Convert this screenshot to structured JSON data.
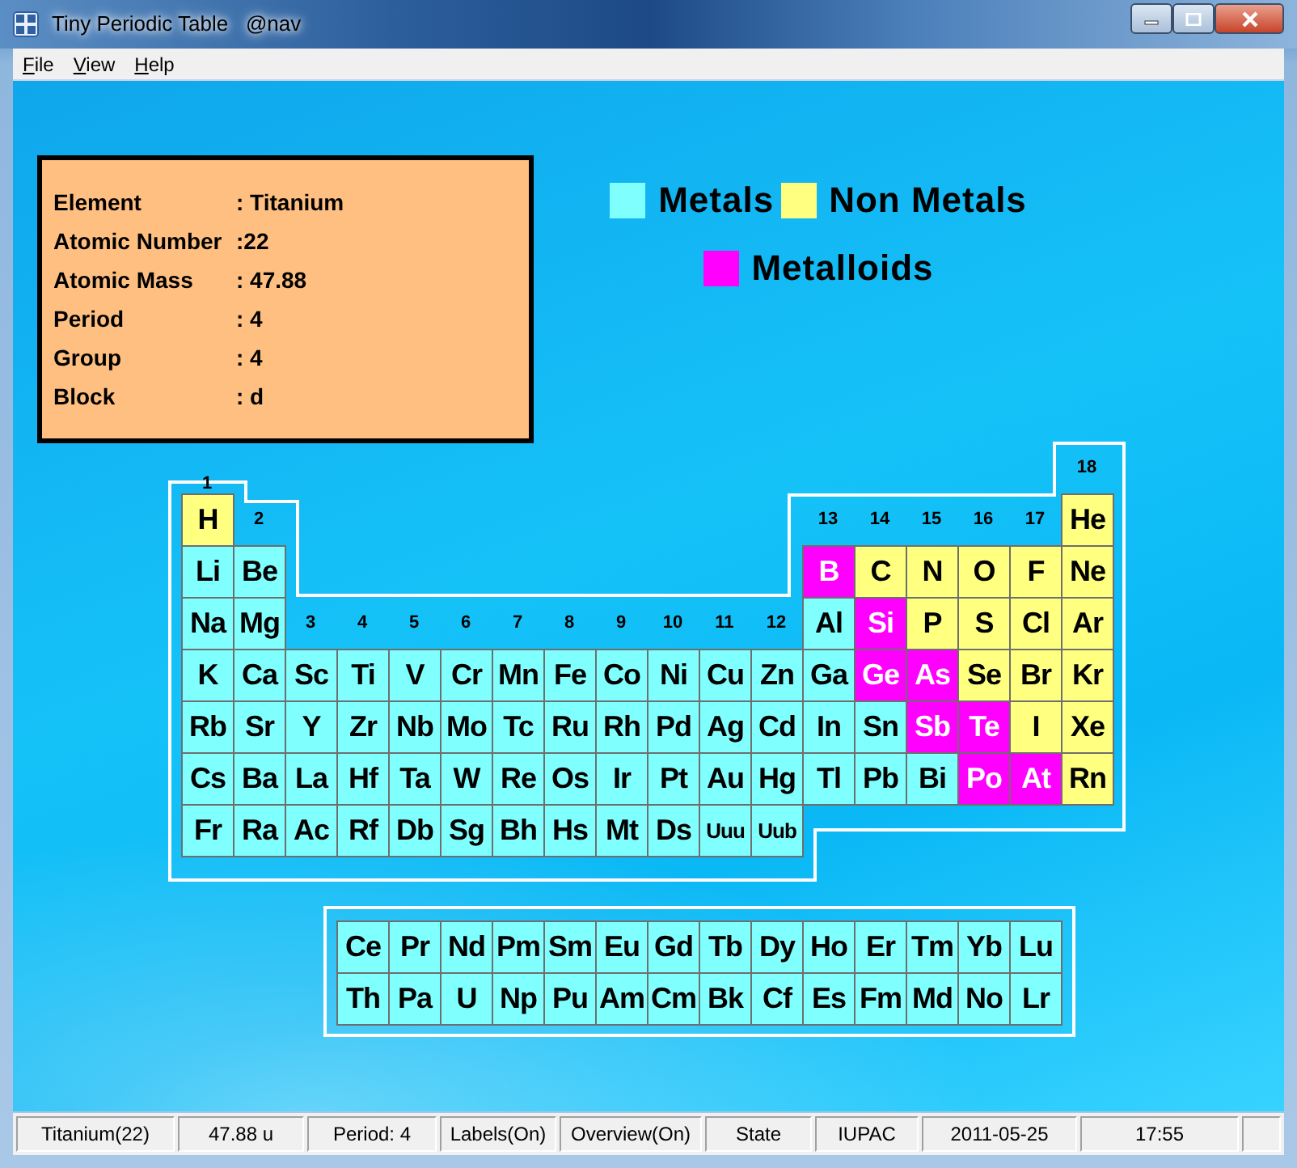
{
  "window": {
    "title": "Tiny Periodic Table   @nav"
  },
  "menu": [
    "File",
    "View",
    "Help"
  ],
  "info": [
    {
      "label": "Element",
      "value": ": Titanium"
    },
    {
      "label": "Atomic Number",
      "value": ":22"
    },
    {
      "label": "Atomic Mass",
      "value": ": 47.88"
    },
    {
      "label": "Period",
      "value": ": 4"
    },
    {
      "label": "Group",
      "value": ": 4"
    },
    {
      "label": "Block",
      "value": ": d"
    }
  ],
  "legend": [
    {
      "kind": "metal",
      "label": "Metals",
      "color": "#80ffff"
    },
    {
      "kind": "nonmetal",
      "label": "Non Metals",
      "color": "#ffff80"
    },
    {
      "kind": "metalloid",
      "label": "Metalloids",
      "color": "#ff00ff"
    }
  ],
  "group_labels": [
    "1",
    "2",
    "3",
    "4",
    "5",
    "6",
    "7",
    "8",
    "9",
    "10",
    "11",
    "12",
    "13",
    "14",
    "15",
    "16",
    "17",
    "18"
  ],
  "table": {
    "rows": [
      [
        {
          "symbol": "H",
          "kind": "nonmetal"
        },
        null,
        null,
        null,
        null,
        null,
        null,
        null,
        null,
        null,
        null,
        null,
        null,
        null,
        null,
        null,
        null,
        {
          "symbol": "He",
          "kind": "nonmetal"
        }
      ],
      [
        {
          "symbol": "Li",
          "kind": "metal"
        },
        {
          "symbol": "Be",
          "kind": "metal"
        },
        null,
        null,
        null,
        null,
        null,
        null,
        null,
        null,
        null,
        null,
        {
          "symbol": "B",
          "kind": "metalloid"
        },
        {
          "symbol": "C",
          "kind": "nonmetal"
        },
        {
          "symbol": "N",
          "kind": "nonmetal"
        },
        {
          "symbol": "O",
          "kind": "nonmetal"
        },
        {
          "symbol": "F",
          "kind": "nonmetal"
        },
        {
          "symbol": "Ne",
          "kind": "nonmetal"
        }
      ],
      [
        {
          "symbol": "Na",
          "kind": "metal"
        },
        {
          "symbol": "Mg",
          "kind": "metal"
        },
        null,
        null,
        null,
        null,
        null,
        null,
        null,
        null,
        null,
        null,
        {
          "symbol": "Al",
          "kind": "metal"
        },
        {
          "symbol": "Si",
          "kind": "metalloid"
        },
        {
          "symbol": "P",
          "kind": "nonmetal"
        },
        {
          "symbol": "S",
          "kind": "nonmetal"
        },
        {
          "symbol": "Cl",
          "kind": "nonmetal"
        },
        {
          "symbol": "Ar",
          "kind": "nonmetal"
        }
      ],
      [
        {
          "symbol": "K",
          "kind": "metal"
        },
        {
          "symbol": "Ca",
          "kind": "metal"
        },
        {
          "symbol": "Sc",
          "kind": "metal"
        },
        {
          "symbol": "Ti",
          "kind": "metal"
        },
        {
          "symbol": "V",
          "kind": "metal"
        },
        {
          "symbol": "Cr",
          "kind": "metal"
        },
        {
          "symbol": "Mn",
          "kind": "metal"
        },
        {
          "symbol": "Fe",
          "kind": "metal"
        },
        {
          "symbol": "Co",
          "kind": "metal"
        },
        {
          "symbol": "Ni",
          "kind": "metal"
        },
        {
          "symbol": "Cu",
          "kind": "metal"
        },
        {
          "symbol": "Zn",
          "kind": "metal"
        },
        {
          "symbol": "Ga",
          "kind": "metal"
        },
        {
          "symbol": "Ge",
          "kind": "metalloid"
        },
        {
          "symbol": "As",
          "kind": "metalloid"
        },
        {
          "symbol": "Se",
          "kind": "nonmetal"
        },
        {
          "symbol": "Br",
          "kind": "nonmetal"
        },
        {
          "symbol": "Kr",
          "kind": "nonmetal"
        }
      ],
      [
        {
          "symbol": "Rb",
          "kind": "metal"
        },
        {
          "symbol": "Sr",
          "kind": "metal"
        },
        {
          "symbol": "Y",
          "kind": "metal"
        },
        {
          "symbol": "Zr",
          "kind": "metal"
        },
        {
          "symbol": "Nb",
          "kind": "metal"
        },
        {
          "symbol": "Mo",
          "kind": "metal"
        },
        {
          "symbol": "Tc",
          "kind": "metal"
        },
        {
          "symbol": "Ru",
          "kind": "metal"
        },
        {
          "symbol": "Rh",
          "kind": "metal"
        },
        {
          "symbol": "Pd",
          "kind": "metal"
        },
        {
          "symbol": "Ag",
          "kind": "metal"
        },
        {
          "symbol": "Cd",
          "kind": "metal"
        },
        {
          "symbol": "In",
          "kind": "metal"
        },
        {
          "symbol": "Sn",
          "kind": "metal"
        },
        {
          "symbol": "Sb",
          "kind": "metalloid"
        },
        {
          "symbol": "Te",
          "kind": "metalloid"
        },
        {
          "symbol": "I",
          "kind": "nonmetal"
        },
        {
          "symbol": "Xe",
          "kind": "nonmetal"
        }
      ],
      [
        {
          "symbol": "Cs",
          "kind": "metal"
        },
        {
          "symbol": "Ba",
          "kind": "metal"
        },
        {
          "symbol": "La",
          "kind": "metal"
        },
        {
          "symbol": "Hf",
          "kind": "metal"
        },
        {
          "symbol": "Ta",
          "kind": "metal"
        },
        {
          "symbol": "W",
          "kind": "metal"
        },
        {
          "symbol": "Re",
          "kind": "metal"
        },
        {
          "symbol": "Os",
          "kind": "metal"
        },
        {
          "symbol": "Ir",
          "kind": "metal"
        },
        {
          "symbol": "Pt",
          "kind": "metal"
        },
        {
          "symbol": "Au",
          "kind": "metal"
        },
        {
          "symbol": "Hg",
          "kind": "metal"
        },
        {
          "symbol": "Tl",
          "kind": "metal"
        },
        {
          "symbol": "Pb",
          "kind": "metal"
        },
        {
          "symbol": "Bi",
          "kind": "metal"
        },
        {
          "symbol": "Po",
          "kind": "metalloid"
        },
        {
          "symbol": "At",
          "kind": "metalloid"
        },
        {
          "symbol": "Rn",
          "kind": "nonmetal"
        }
      ],
      [
        {
          "symbol": "Fr",
          "kind": "metal"
        },
        {
          "symbol": "Ra",
          "kind": "metal"
        },
        {
          "symbol": "Ac",
          "kind": "metal"
        },
        {
          "symbol": "Rf",
          "kind": "metal"
        },
        {
          "symbol": "Db",
          "kind": "metal"
        },
        {
          "symbol": "Sg",
          "kind": "metal"
        },
        {
          "symbol": "Bh",
          "kind": "metal"
        },
        {
          "symbol": "Hs",
          "kind": "metal"
        },
        {
          "symbol": "Mt",
          "kind": "metal"
        },
        {
          "symbol": "Ds",
          "kind": "metal"
        },
        {
          "symbol": "Uuu",
          "kind": "metal"
        },
        {
          "symbol": "Uub",
          "kind": "metal"
        },
        null,
        null,
        null,
        null,
        null,
        null
      ]
    ]
  },
  "f_block": {
    "rows": [
      [
        {
          "symbol": "Ce",
          "kind": "metal"
        },
        {
          "symbol": "Pr",
          "kind": "metal"
        },
        {
          "symbol": "Nd",
          "kind": "metal"
        },
        {
          "symbol": "Pm",
          "kind": "metal"
        },
        {
          "symbol": "Sm",
          "kind": "metal"
        },
        {
          "symbol": "Eu",
          "kind": "metal"
        },
        {
          "symbol": "Gd",
          "kind": "metal"
        },
        {
          "symbol": "Tb",
          "kind": "metal"
        },
        {
          "symbol": "Dy",
          "kind": "metal"
        },
        {
          "symbol": "Ho",
          "kind": "metal"
        },
        {
          "symbol": "Er",
          "kind": "metal"
        },
        {
          "symbol": "Tm",
          "kind": "metal"
        },
        {
          "symbol": "Yb",
          "kind": "metal"
        },
        {
          "symbol": "Lu",
          "kind": "metal"
        }
      ],
      [
        {
          "symbol": "Th",
          "kind": "metal"
        },
        {
          "symbol": "Pa",
          "kind": "metal"
        },
        {
          "symbol": "U",
          "kind": "metal"
        },
        {
          "symbol": "Np",
          "kind": "metal"
        },
        {
          "symbol": "Pu",
          "kind": "metal"
        },
        {
          "symbol": "Am",
          "kind": "metal"
        },
        {
          "symbol": "Cm",
          "kind": "metal"
        },
        {
          "symbol": "Bk",
          "kind": "metal"
        },
        {
          "symbol": "Cf",
          "kind": "metal"
        },
        {
          "symbol": "Es",
          "kind": "metal"
        },
        {
          "symbol": "Fm",
          "kind": "metal"
        },
        {
          "symbol": "Md",
          "kind": "metal"
        },
        {
          "symbol": "No",
          "kind": "metal"
        },
        {
          "symbol": "Lr",
          "kind": "metal"
        }
      ]
    ]
  },
  "status_bar": [
    "Titanium(22)",
    "47.88 u",
    "Period: 4",
    "Labels(On)",
    "Overview(On)",
    "State",
    "IUPAC",
    "2011-05-25",
    "17:55"
  ]
}
